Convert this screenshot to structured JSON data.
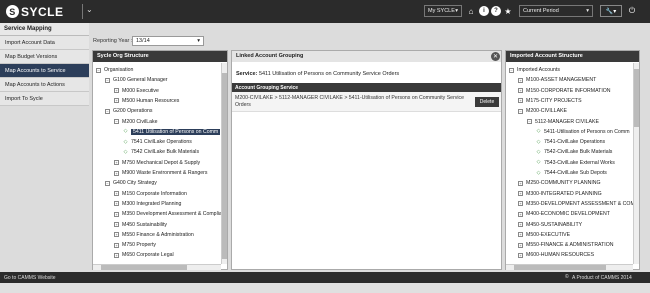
{
  "app": {
    "logo_text": "SYCLE",
    "logo_mark": "S"
  },
  "topbar": {
    "cycle_select": "My SYCLE",
    "period_select": "Current Period",
    "icons": [
      "home-icon",
      "info-icon",
      "help-icon",
      "star-icon",
      "wrench-icon",
      "power-icon"
    ]
  },
  "section_title": "Service Mapping",
  "nav": {
    "items": [
      {
        "label": "Import Account Data",
        "active": false
      },
      {
        "label": "Map Budget Versions",
        "active": false
      },
      {
        "label": "Map Accounts to Service",
        "active": true
      },
      {
        "label": "Map Accounts to Actions",
        "active": false
      },
      {
        "label": "Import To Sycle",
        "active": false
      }
    ]
  },
  "reporting_year": {
    "label": "Reporting Year :",
    "value": "13/14"
  },
  "org_panel": {
    "title": "Sycle Org Structure",
    "rows": [
      {
        "text": "Organisation",
        "level": 0,
        "type": "minus"
      },
      {
        "text": "G100 General Manager",
        "level": 1,
        "type": "minus"
      },
      {
        "text": "M000 Executive",
        "level": 2,
        "type": "plus"
      },
      {
        "text": "M500 Human Resources",
        "level": 2,
        "type": "plus"
      },
      {
        "text": "G200 Operations",
        "level": 1,
        "type": "minus"
      },
      {
        "text": "M200 CivilLake",
        "level": 2,
        "type": "minus"
      },
      {
        "text": "5411 Utilisation of Persons on Comm",
        "level": 3,
        "type": "leaf",
        "selected": true
      },
      {
        "text": "7541 CivilLake Operations",
        "level": 3,
        "type": "leaf"
      },
      {
        "text": "7542 CivilLake Bulk Materials",
        "level": 3,
        "type": "leaf"
      },
      {
        "text": "M750 Mechanical Depot & Supply",
        "level": 2,
        "type": "plus"
      },
      {
        "text": "M900 Waste Environment & Rangers",
        "level": 2,
        "type": "plus"
      },
      {
        "text": "G400 City Strategy",
        "level": 1,
        "type": "minus"
      },
      {
        "text": "M150 Corporate Information",
        "level": 2,
        "type": "plus"
      },
      {
        "text": "M300 Integrated Planning",
        "level": 2,
        "type": "plus"
      },
      {
        "text": "M350 Development Assessment & Complian",
        "level": 2,
        "type": "plus"
      },
      {
        "text": "M450 Sustainability",
        "level": 2,
        "type": "plus"
      },
      {
        "text": "M550 Finance & Administration",
        "level": 2,
        "type": "plus"
      },
      {
        "text": "M750 Property",
        "level": 2,
        "type": "plus"
      },
      {
        "text": "M650 Corporate Legal",
        "level": 2,
        "type": "plus"
      }
    ]
  },
  "linked_panel": {
    "title": "Linked Account Grouping",
    "service_label": "Service:",
    "service_value": "5411 Utilisation of Persons on Community Service Orders",
    "table_header": "Account Grouping Service",
    "row_text": "M200-CIVILAKE > 5112-MANAGER CIVILAKE > 5411-Utilisation of Persons on Community Service Orders",
    "delete_label": "Delete"
  },
  "imported_panel": {
    "title": "Imported Account Structure",
    "rows": [
      {
        "text": "Imported Accounts",
        "level": 0,
        "type": "minus"
      },
      {
        "text": "M100-ASSET MANAGEMENT",
        "level": 1,
        "type": "plus"
      },
      {
        "text": "M150-CORPORATE INFORMATION",
        "level": 1,
        "type": "plus"
      },
      {
        "text": "M175-CITY PROJECTS",
        "level": 1,
        "type": "plus"
      },
      {
        "text": "M200-CIVILLAKE",
        "level": 1,
        "type": "minus"
      },
      {
        "text": "5112-MANAGER CIVILAKE",
        "level": 2,
        "type": "minus"
      },
      {
        "text": "5411-Utilisation of Persons on Comm",
        "level": 3,
        "type": "leaf"
      },
      {
        "text": "7541-CivilLake Operations",
        "level": 3,
        "type": "leaf"
      },
      {
        "text": "7542-CivilLake Bulk Materials",
        "level": 3,
        "type": "leaf"
      },
      {
        "text": "7543-CivilLake External Works",
        "level": 3,
        "type": "leaf"
      },
      {
        "text": "7544-CivilLake Sub Depots",
        "level": 3,
        "type": "leaf"
      },
      {
        "text": "M250-COMMUNITY PLANNING",
        "level": 1,
        "type": "plus"
      },
      {
        "text": "M300-INTEGRATED PLANNING",
        "level": 1,
        "type": "plus"
      },
      {
        "text": "M350-DEVELOPMENT ASSESSMENT & COMP",
        "level": 1,
        "type": "plus"
      },
      {
        "text": "M400-ECONOMIC DEVELOPMENT",
        "level": 1,
        "type": "plus"
      },
      {
        "text": "M450-SUSTAINABILITY",
        "level": 1,
        "type": "plus"
      },
      {
        "text": "M500-EXECUTIVE",
        "level": 1,
        "type": "plus"
      },
      {
        "text": "M550-FINANCE & ADMINISTRATION",
        "level": 1,
        "type": "plus"
      },
      {
        "text": "M600-HUMAN RESOURCES",
        "level": 1,
        "type": "plus"
      }
    ]
  },
  "footer": {
    "left": "Go to CAMMS Website",
    "right": "A Product of CAMMS 2014"
  }
}
